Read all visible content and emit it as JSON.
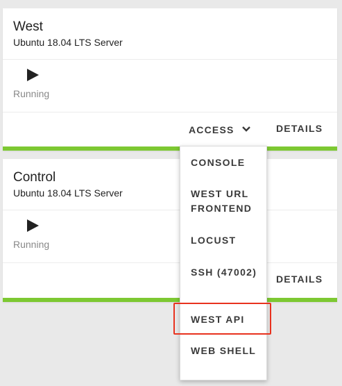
{
  "cards": [
    {
      "title": "West",
      "subtitle": "Ubuntu 18.04 LTS Server",
      "status": "Running",
      "access_label": "ACCESS",
      "details_label": "DETAILS"
    },
    {
      "title": "Control",
      "subtitle": "Ubuntu 18.04 LTS Server",
      "status": "Running",
      "details_label": "DETAILS"
    }
  ],
  "access_menu": {
    "items": [
      {
        "label": "CONSOLE"
      },
      {
        "label": "WEST URL FRONTEND"
      },
      {
        "label": "LOCUST"
      },
      {
        "label": "SSH (47002)"
      },
      {
        "label": "WEST API",
        "highlighted": true
      },
      {
        "label": "WEB SHELL"
      }
    ]
  },
  "colors": {
    "status_bar": "#7dc832",
    "highlight_border": "#e8321e",
    "background": "#e9e9e9"
  },
  "icons": {
    "status": "play-icon",
    "dropdown": "chevron-down-icon"
  }
}
